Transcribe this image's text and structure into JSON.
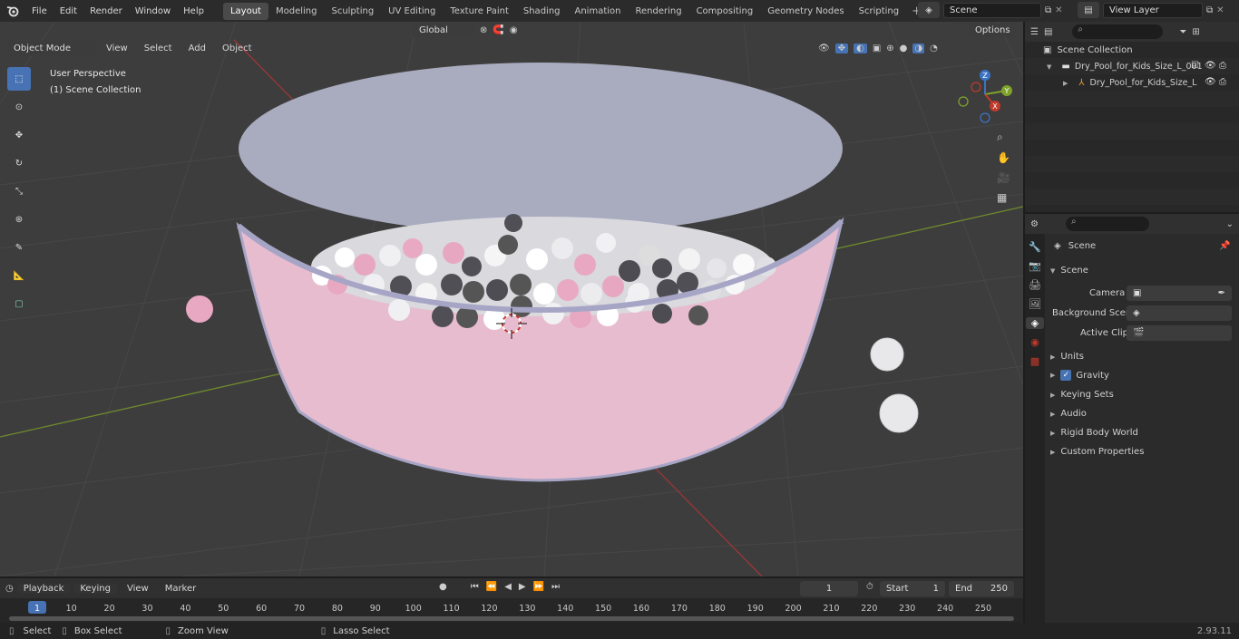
{
  "menus": [
    "File",
    "Edit",
    "Render",
    "Window",
    "Help"
  ],
  "workspaces": [
    "Layout",
    "Modeling",
    "Sculpting",
    "UV Editing",
    "Texture Paint",
    "Shading",
    "Animation",
    "Rendering",
    "Compositing",
    "Geometry Nodes",
    "Scripting"
  ],
  "active_workspace": "Layout",
  "scene_field": "Scene",
  "view_layer_field": "View Layer",
  "viewport": {
    "mode": "Object Mode",
    "menus": [
      "View",
      "Select",
      "Add",
      "Object"
    ],
    "transform_orientation": "Global",
    "options_label": "Options",
    "perspective_label": "User Perspective",
    "collection_label": "(1) Scene Collection",
    "gizmo_axes": {
      "x": "X",
      "y": "Y",
      "z": "Z"
    }
  },
  "outliner": {
    "root": "Scene Collection",
    "items": [
      "Dry_Pool_for_Kids_Size_L_001",
      "Dry_Pool_for_Kids_Size_L"
    ]
  },
  "properties": {
    "header": "Scene",
    "panel": "Scene",
    "fields": {
      "camera": "Camera",
      "background_scene": "Background Scene",
      "active_clip": "Active Clip"
    },
    "sections": [
      "Units",
      "Gravity",
      "Keying Sets",
      "Audio",
      "Rigid Body World",
      "Custom Properties"
    ],
    "gravity_checked": true
  },
  "timeline": {
    "menus": [
      "Playback",
      "Keying",
      "View",
      "Marker"
    ],
    "current_frame": "1",
    "start_label": "Start",
    "start": "1",
    "end_label": "End",
    "end": "250",
    "ticks": [
      "1",
      "10",
      "20",
      "30",
      "40",
      "50",
      "60",
      "70",
      "80",
      "90",
      "100",
      "110",
      "120",
      "130",
      "140",
      "150",
      "160",
      "170",
      "180",
      "190",
      "200",
      "210",
      "220",
      "230",
      "240",
      "250"
    ]
  },
  "statusbar": {
    "select": "Select",
    "box_select": "Box Select",
    "zoom_view": "Zoom View",
    "lasso_select": "Lasso Select",
    "version": "2.93.11"
  },
  "colors": {
    "accent": "#4772b3",
    "pool": "#e9bccd",
    "viewport_bg": "#3d3d3d",
    "x_axis": "#c0392b",
    "y_axis": "#7fa32a"
  }
}
